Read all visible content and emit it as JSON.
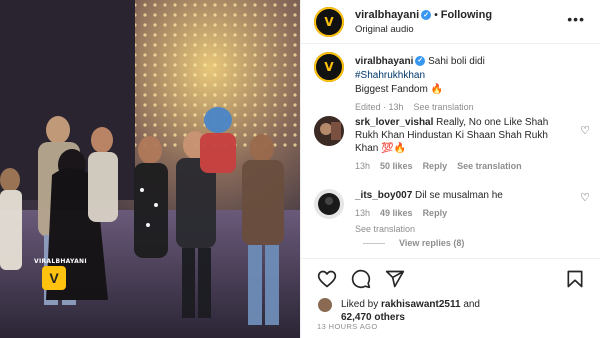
{
  "media": {
    "watermark_text": "VIRALBHAYANI",
    "watermark_logo": "V",
    "alt_scene": "people-on-stage-video"
  },
  "header": {
    "avatar_logo": "V",
    "username": "viralbhayani",
    "verified_glyph": "✓",
    "separator": "•",
    "follow_status": "Following",
    "audio_label": "Original audio",
    "more_icon": "more-horizontal-icon"
  },
  "caption": {
    "avatar_logo": "V",
    "username": "viralbhayani",
    "verified_glyph": "✓",
    "text_line1": "Sahi boli didi",
    "hashtag": "#Shahrukhkhan",
    "text_line3": "Biggest Fandom",
    "emoji": "🔥",
    "edited": "Edited · 13h",
    "see_translation": "See translation"
  },
  "comments": [
    {
      "username": "srk_lover_vishal",
      "text": "Really, No one Like Shah Rukh Khan Hindustan Ki Shaan Shah Rukh Khan",
      "emoji": "💯🔥",
      "age": "13h",
      "likes": "50 likes",
      "reply": "Reply",
      "see_translation": "See translation"
    },
    {
      "username": "_its_boy007",
      "text": "Dil se musalman he",
      "age": "13h",
      "likes": "49 likes",
      "reply": "Reply",
      "see_translation": "See translation"
    }
  ],
  "replies_link": "View replies (8)",
  "actions": {
    "like_icon": "heart-icon",
    "comment_icon": "comment-icon",
    "share_icon": "share-icon",
    "save_icon": "bookmark-icon"
  },
  "likes": {
    "prefix": "Liked by",
    "user": "rakhisawant2511",
    "connector": "and",
    "others": "62,470 others"
  },
  "timestamp": "13 HOURS AGO",
  "colors": {
    "brand_yellow": "#ffc20e",
    "verified_blue": "#3897f0",
    "hashtag_blue": "#00376b",
    "muted_gray": "#8e8e8e"
  }
}
